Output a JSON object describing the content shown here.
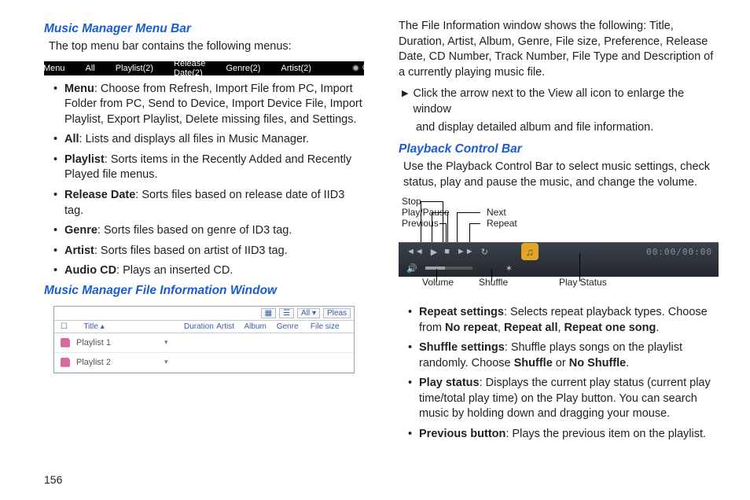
{
  "page_number": "156",
  "left": {
    "section1_title": "Music Manager Menu Bar",
    "section1_intro": "The top menu bar contains the following menus:",
    "menubar": {
      "menu": "Menu",
      "all": "All",
      "playlist": "Playlist(2)",
      "release": "Release Date(2)",
      "genre": "Genre(2)",
      "artist": "Artist(2)",
      "cd": "CD"
    },
    "bullets1": [
      {
        "term": "Menu",
        "desc": ": Choose from Refresh, Import File from PC, Import Folder from PC, Send to Device, Import Device File, Import Playlist, Export Playlist, Delete missing files, and Settings."
      },
      {
        "term": "All",
        "desc": ": Lists and displays all files in Music Manager."
      },
      {
        "term": "Playlist",
        "desc": ": Sorts items in the Recently Added and Recently Played file menus."
      },
      {
        "term": "Release Date",
        "desc": ": Sorts files based on release date of IID3 tag."
      },
      {
        "term": "Genre",
        "desc": ": Sorts files based on genre of ID3 tag."
      },
      {
        "term": "Artist",
        "desc": ": Sorts files based on artist of IID3 tag."
      },
      {
        "term": "Audio CD",
        "desc": ": Plays an inserted CD."
      }
    ],
    "section2_title": "Music Manager File Information Window",
    "fileinfo": {
      "tool_all": "All",
      "tool_please": "Pleas",
      "head": {
        "cb": "☐",
        "title": "Title ▴",
        "duration": "Duration",
        "artist": "Artist",
        "album": "Album",
        "genre": "Genre",
        "filesize": "File size"
      },
      "rows": [
        {
          "name": "Playlist 1"
        },
        {
          "name": "Playlist 2"
        }
      ]
    }
  },
  "right": {
    "para1": "The File Information window shows the following: Title, Duration, Artist, Album, Genre, File size, Preference, Release Date, CD Number, Track Number, File Type and Description of a currently playing music file.",
    "arrow1": "Click the arrow next to the View all icon to enlarge the window",
    "arrow1_cont": "and display detailed album and file information.",
    "section_title": "Playback Control Bar",
    "section_intro": "Use the Playback Control Bar to select music settings, check status, play and pause the music, and change the volume.",
    "diag_labels": {
      "stop": "Stop",
      "playpause": "Play/Pause",
      "previous": "Previous",
      "next": "Next",
      "repeat": "Repeat",
      "volume": "Volume",
      "shuffle": "Shuffle",
      "playstatus": "Play Status",
      "timer": "00:00/00:00"
    },
    "bullets": [
      {
        "term": "Repeat settings",
        "desc_pre": ": Selects repeat playback types. Choose from ",
        "b1": "No repeat",
        "sep1": ", ",
        "b2": "Repeat all",
        "sep2": ", ",
        "b3": "Repeat one song",
        "post": "."
      },
      {
        "term": "Shuffle settings",
        "desc_pre": ": Shuffle plays songs on the playlist randomly. Choose ",
        "b1": "Shuffle",
        "sep1": " or ",
        "b2": "No Shuffle",
        "post": "."
      },
      {
        "term": "Play status",
        "desc_pre": ": Displays the current play status (current play time/total play time) on the Play button. You can search music by holding down and dragging your mouse."
      },
      {
        "term": "Previous button",
        "desc_pre": ": Plays the previous item on the playlist."
      }
    ]
  }
}
